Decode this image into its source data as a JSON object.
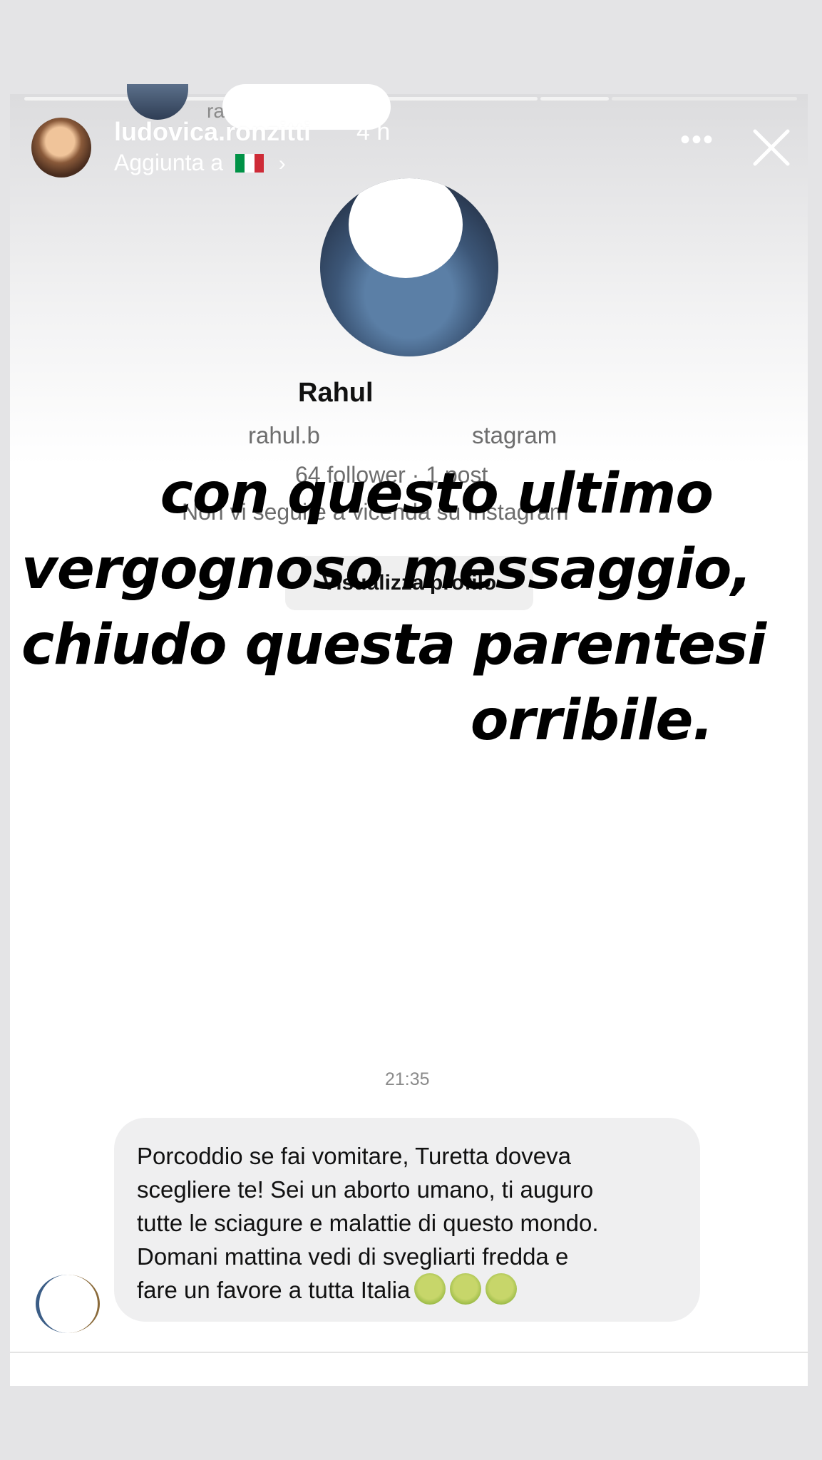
{
  "story": {
    "username": "ludovica.ronzitti",
    "age": "4 h",
    "added_to_label": "Aggiunta a",
    "chevron": "›",
    "more_label": "•••",
    "stub_label": "ra",
    "flag_colors": [
      "#009246",
      "#ffffff",
      "#ce2b37"
    ]
  },
  "profile": {
    "name": "Rahul",
    "handle": "rahul.b",
    "handle_tail": "stagram",
    "stats": "64 follower · 1 post",
    "mutual": "Non vi seguite a vicenda su Instagram",
    "view_button": "Visualizza profilo"
  },
  "overlay_text": {
    "line1": "con questo ultimo",
    "line2": "vergognoso messaggio,",
    "line3": "chiudo questa parentesi",
    "line4": "orribile."
  },
  "chat": {
    "timestamp": "21:35",
    "message_lines": [
      "Porcoddio se fai vomitare, Turetta doveva",
      "scegliere te! Sei un aborto umano, ti auguro",
      "tutte le sciagure e malattie di questo mondo.",
      "Domani mattina vedi di svegliarti fredda e",
      "fare un favore a tutta Italia"
    ],
    "emoji_icons": [
      "nauseated-face-icon",
      "nauseated-face-icon",
      "nauseated-face-icon"
    ]
  },
  "colors": {
    "progress": "#f3f3f3",
    "bubble": "#efeff0",
    "overlay_text": "#000000"
  }
}
